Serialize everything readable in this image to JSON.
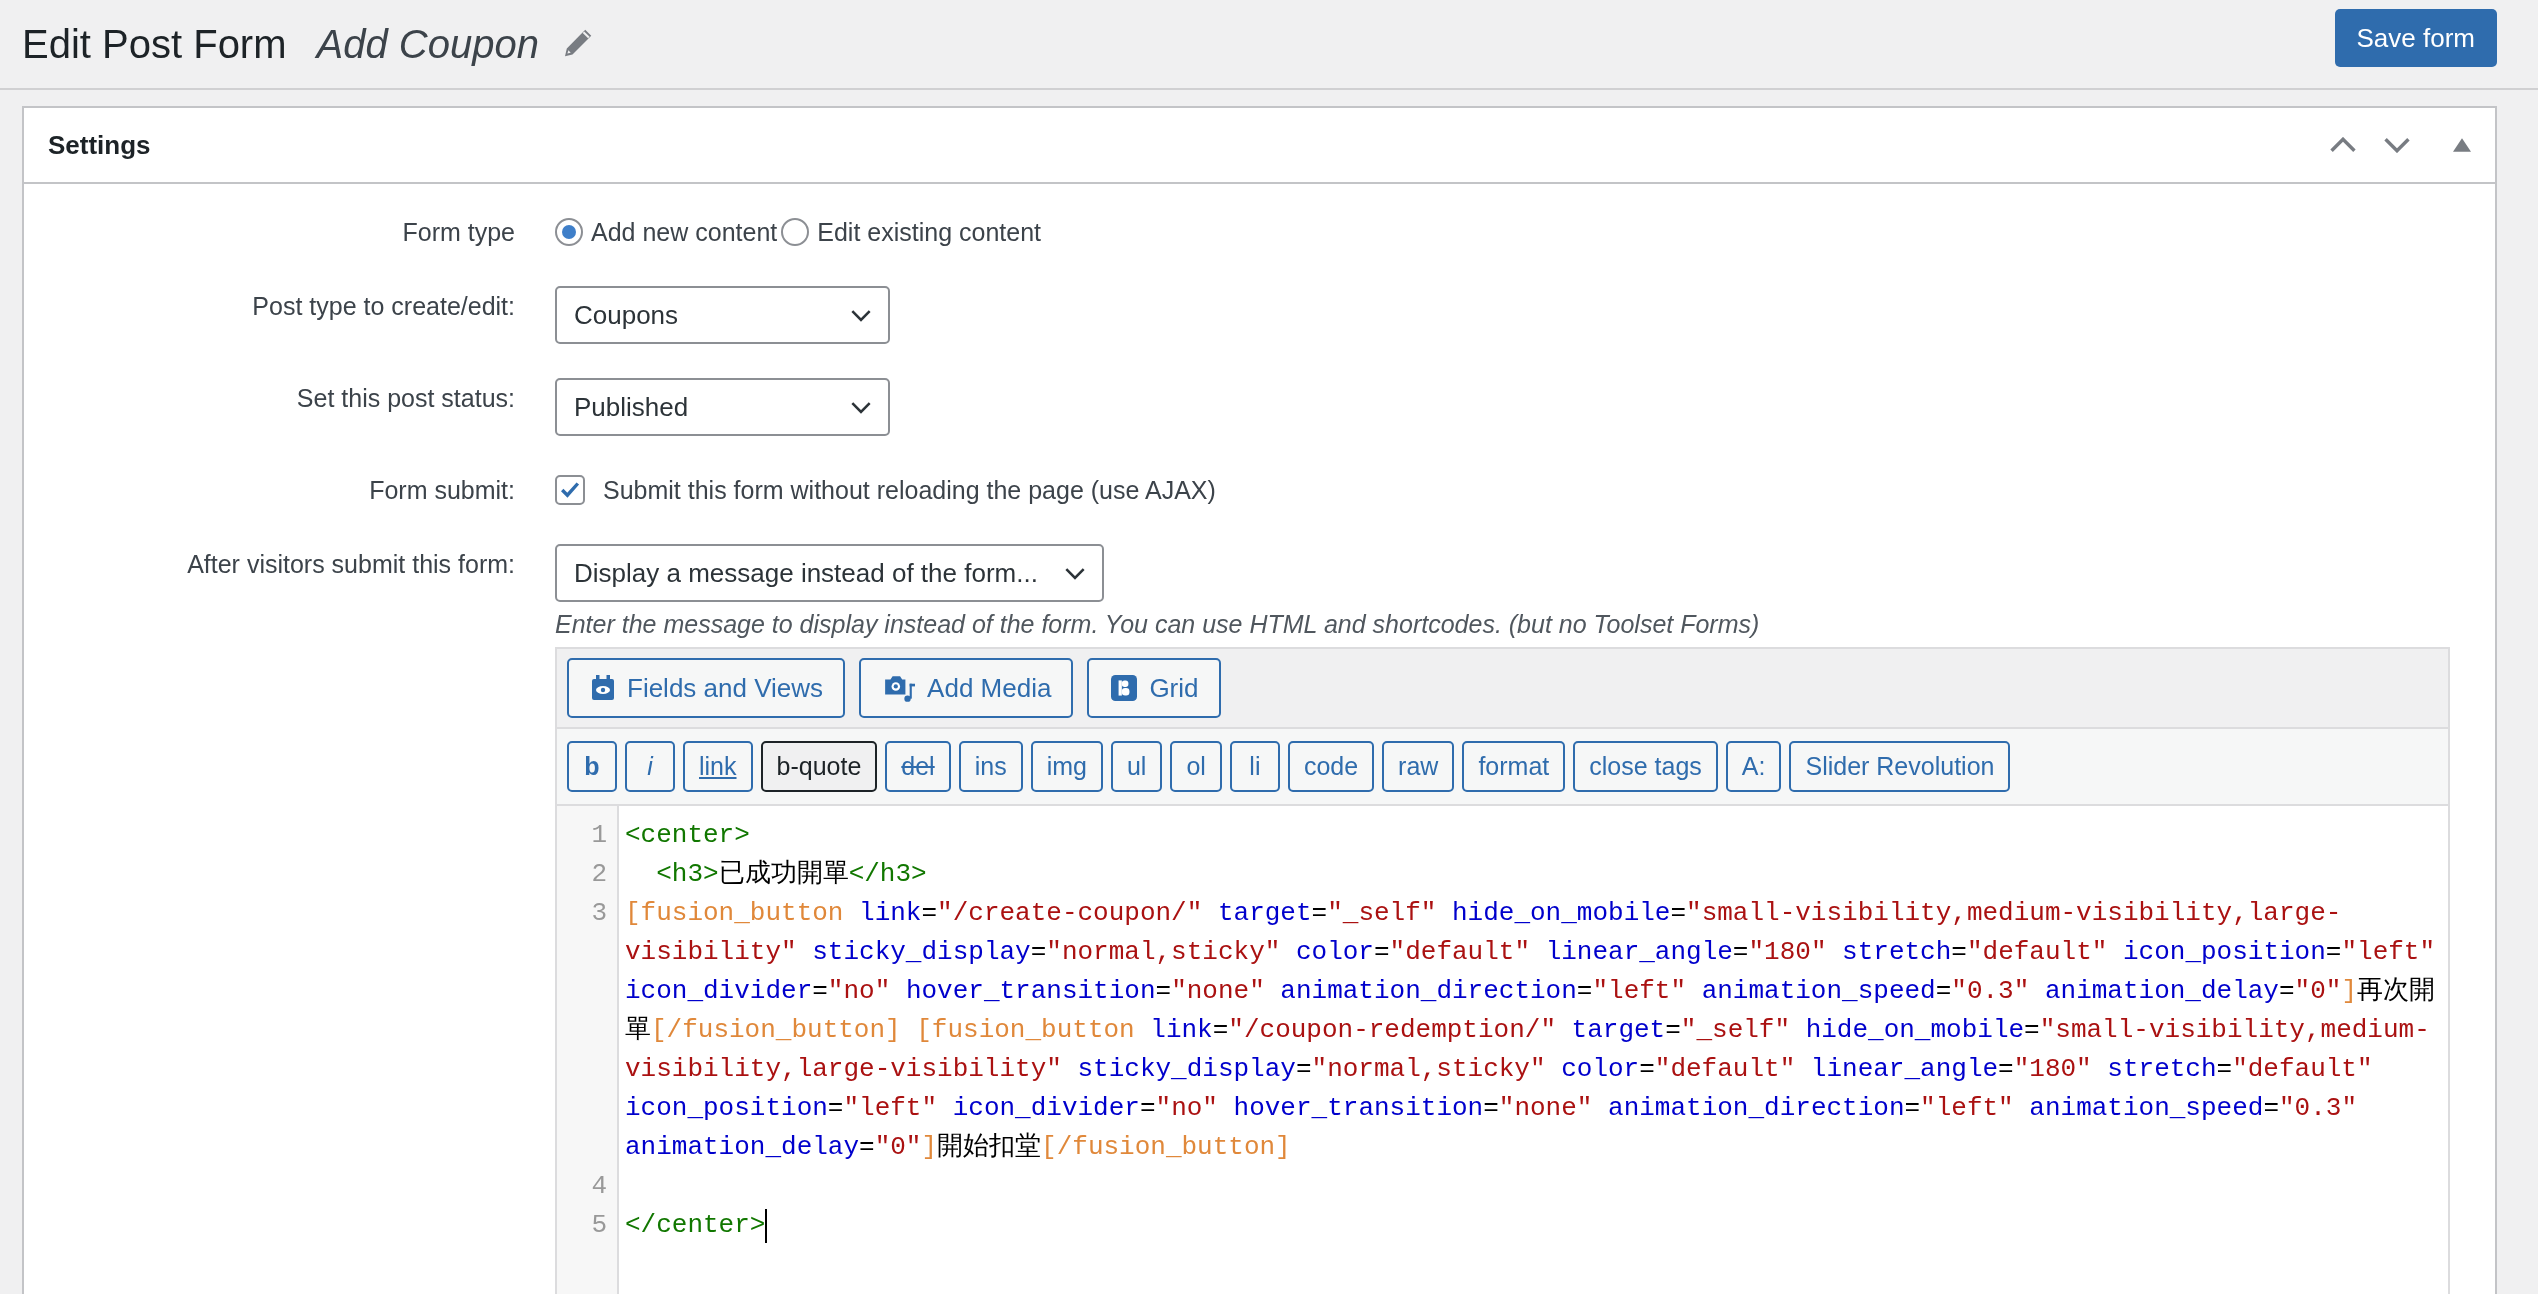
{
  "header": {
    "title": "Edit Post Form",
    "form_name": "Add Coupon",
    "save_button": "Save form"
  },
  "settings": {
    "title": "Settings",
    "rows": [
      {
        "kind": "radio",
        "label": "Form type",
        "options": [
          {
            "label": "Add new content",
            "selected": true
          },
          {
            "label": "Edit existing content",
            "selected": false
          }
        ]
      },
      {
        "kind": "select",
        "label": "Post type to create/edit:",
        "value": "Coupons"
      },
      {
        "kind": "select",
        "label": "Set this post status:",
        "value": "Published"
      },
      {
        "kind": "checkbox",
        "label": "Form submit:",
        "text": "Submit this form without reloading the page (use AJAX)",
        "checked": true
      },
      {
        "kind": "select",
        "label": "After visitors submit this form:",
        "value": "Display a message instead of the form...",
        "hint": "Enter the message to display instead of the form. You can use HTML and shortcodes. (but no Toolset Forms)"
      }
    ]
  },
  "editor": {
    "media_buttons": [
      {
        "label": "Fields and Views"
      },
      {
        "label": "Add Media"
      },
      {
        "label": "Grid"
      }
    ],
    "quicktags": [
      {
        "label": "b",
        "kind": "bold",
        "pressed": false
      },
      {
        "label": "i",
        "kind": "italic",
        "pressed": false
      },
      {
        "label": "link",
        "kind": "link",
        "pressed": false
      },
      {
        "label": "b-quote",
        "kind": "plain",
        "pressed": true
      },
      {
        "label": "del",
        "kind": "strike",
        "pressed": false
      },
      {
        "label": "ins",
        "kind": "plain",
        "pressed": false
      },
      {
        "label": "img",
        "kind": "plain",
        "pressed": false
      },
      {
        "label": "ul",
        "kind": "plain",
        "pressed": false
      },
      {
        "label": "ol",
        "kind": "plain",
        "pressed": false
      },
      {
        "label": "li",
        "kind": "plain",
        "pressed": false
      },
      {
        "label": "code",
        "kind": "plain",
        "pressed": false
      },
      {
        "label": "raw",
        "kind": "plain",
        "pressed": false
      },
      {
        "label": "format",
        "kind": "plain",
        "pressed": false
      },
      {
        "label": "close tags",
        "kind": "plain",
        "pressed": false
      },
      {
        "label": "A:",
        "kind": "plain",
        "pressed": false
      },
      {
        "label": "Slider Revolution",
        "kind": "plain",
        "pressed": false
      }
    ],
    "lines": [
      {
        "number": "1",
        "cursor": false,
        "rows": [
          "<center>"
        ]
      },
      {
        "number": "2",
        "cursor": false,
        "rows": [
          "  <h3>已成功開單</h3>"
        ]
      },
      {
        "number": "3",
        "cursor": false,
        "rows": [
          "[fusion_button link=\"/create-coupon/\" target=\"_self\" hide_on_mobile=\"small-visibility,medium-visibility,large-",
          "visibility\" sticky_display=\"normal,sticky\" color=\"default\" linear_angle=\"180\" stretch=\"default\" icon_position=\"left\"",
          "icon_divider=\"no\" hover_transition=\"none\" animation_direction=\"left\" animation_speed=\"0.3\" animation_delay=\"0\"]再次開",
          "單[/fusion_button] [fusion_button link=\"/coupon-redemption/\" target=\"_self\" hide_on_mobile=\"small-visibility,medium-",
          "visibility,large-visibility\" sticky_display=\"normal,sticky\" color=\"default\" linear_angle=\"180\" stretch=\"default\"",
          "icon_position=\"left\" icon_divider=\"no\" hover_transition=\"none\" animation_direction=\"left\" animation_speed=\"0.3\"",
          "animation_delay=\"0\"]開始扣堂[/fusion_button]"
        ]
      },
      {
        "number": "4",
        "cursor": false,
        "rows": [
          ""
        ]
      },
      {
        "number": "5",
        "cursor": true,
        "rows": [
          "</center>"
        ]
      }
    ]
  }
}
